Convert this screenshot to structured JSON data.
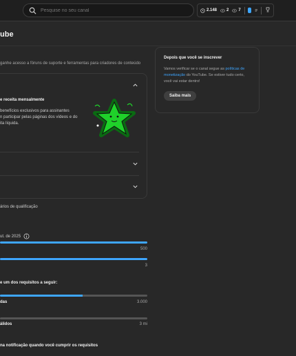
{
  "search": {
    "placeholder": "Pesquise no seu canal"
  },
  "stats": {
    "views": "2.148",
    "likes": "2",
    "comments": "7"
  },
  "page": {
    "title": "ube"
  },
  "intro": {
    "subtitle": "ganhe acesso a fóruns de suporte e ferramentas para criadores de conteúdo"
  },
  "benefits": {
    "title": "e receita mensalmente",
    "text": "benefícios exclusivos para assinantes\nn participar pelas páginas dos vídeos e do\nita líquida."
  },
  "qualification": {
    "text": "ários de qualificação"
  },
  "progress": {
    "date_label": "ut. de 2025",
    "bar1": {
      "fraction": 1.0,
      "max_label": "500"
    },
    "bar2": {
      "fraction": 1.0,
      "max_label": "3"
    },
    "requirement_label": "e um dos requisitos a seguir:",
    "bar3": {
      "label": "das",
      "fraction": 0.56,
      "max_label": "3.000"
    },
    "bar4": {
      "label": "álidos",
      "fraction": 0.0,
      "max_label": "3 mi"
    }
  },
  "notify": {
    "text": "na notificação quando você cumprir os requisitos"
  },
  "side": {
    "title": "Depois que você se inscrever",
    "body_pre": "Vamos verificar se o canal segue as",
    "link": "políticas de monetização",
    "body_post": "do YouTube. Se estiver tudo certo, você vai estar dentro!",
    "button": "Saiba mais"
  },
  "colors": {
    "accent": "#3ea6ff",
    "background": "#282828",
    "star": "#1fd12a"
  }
}
